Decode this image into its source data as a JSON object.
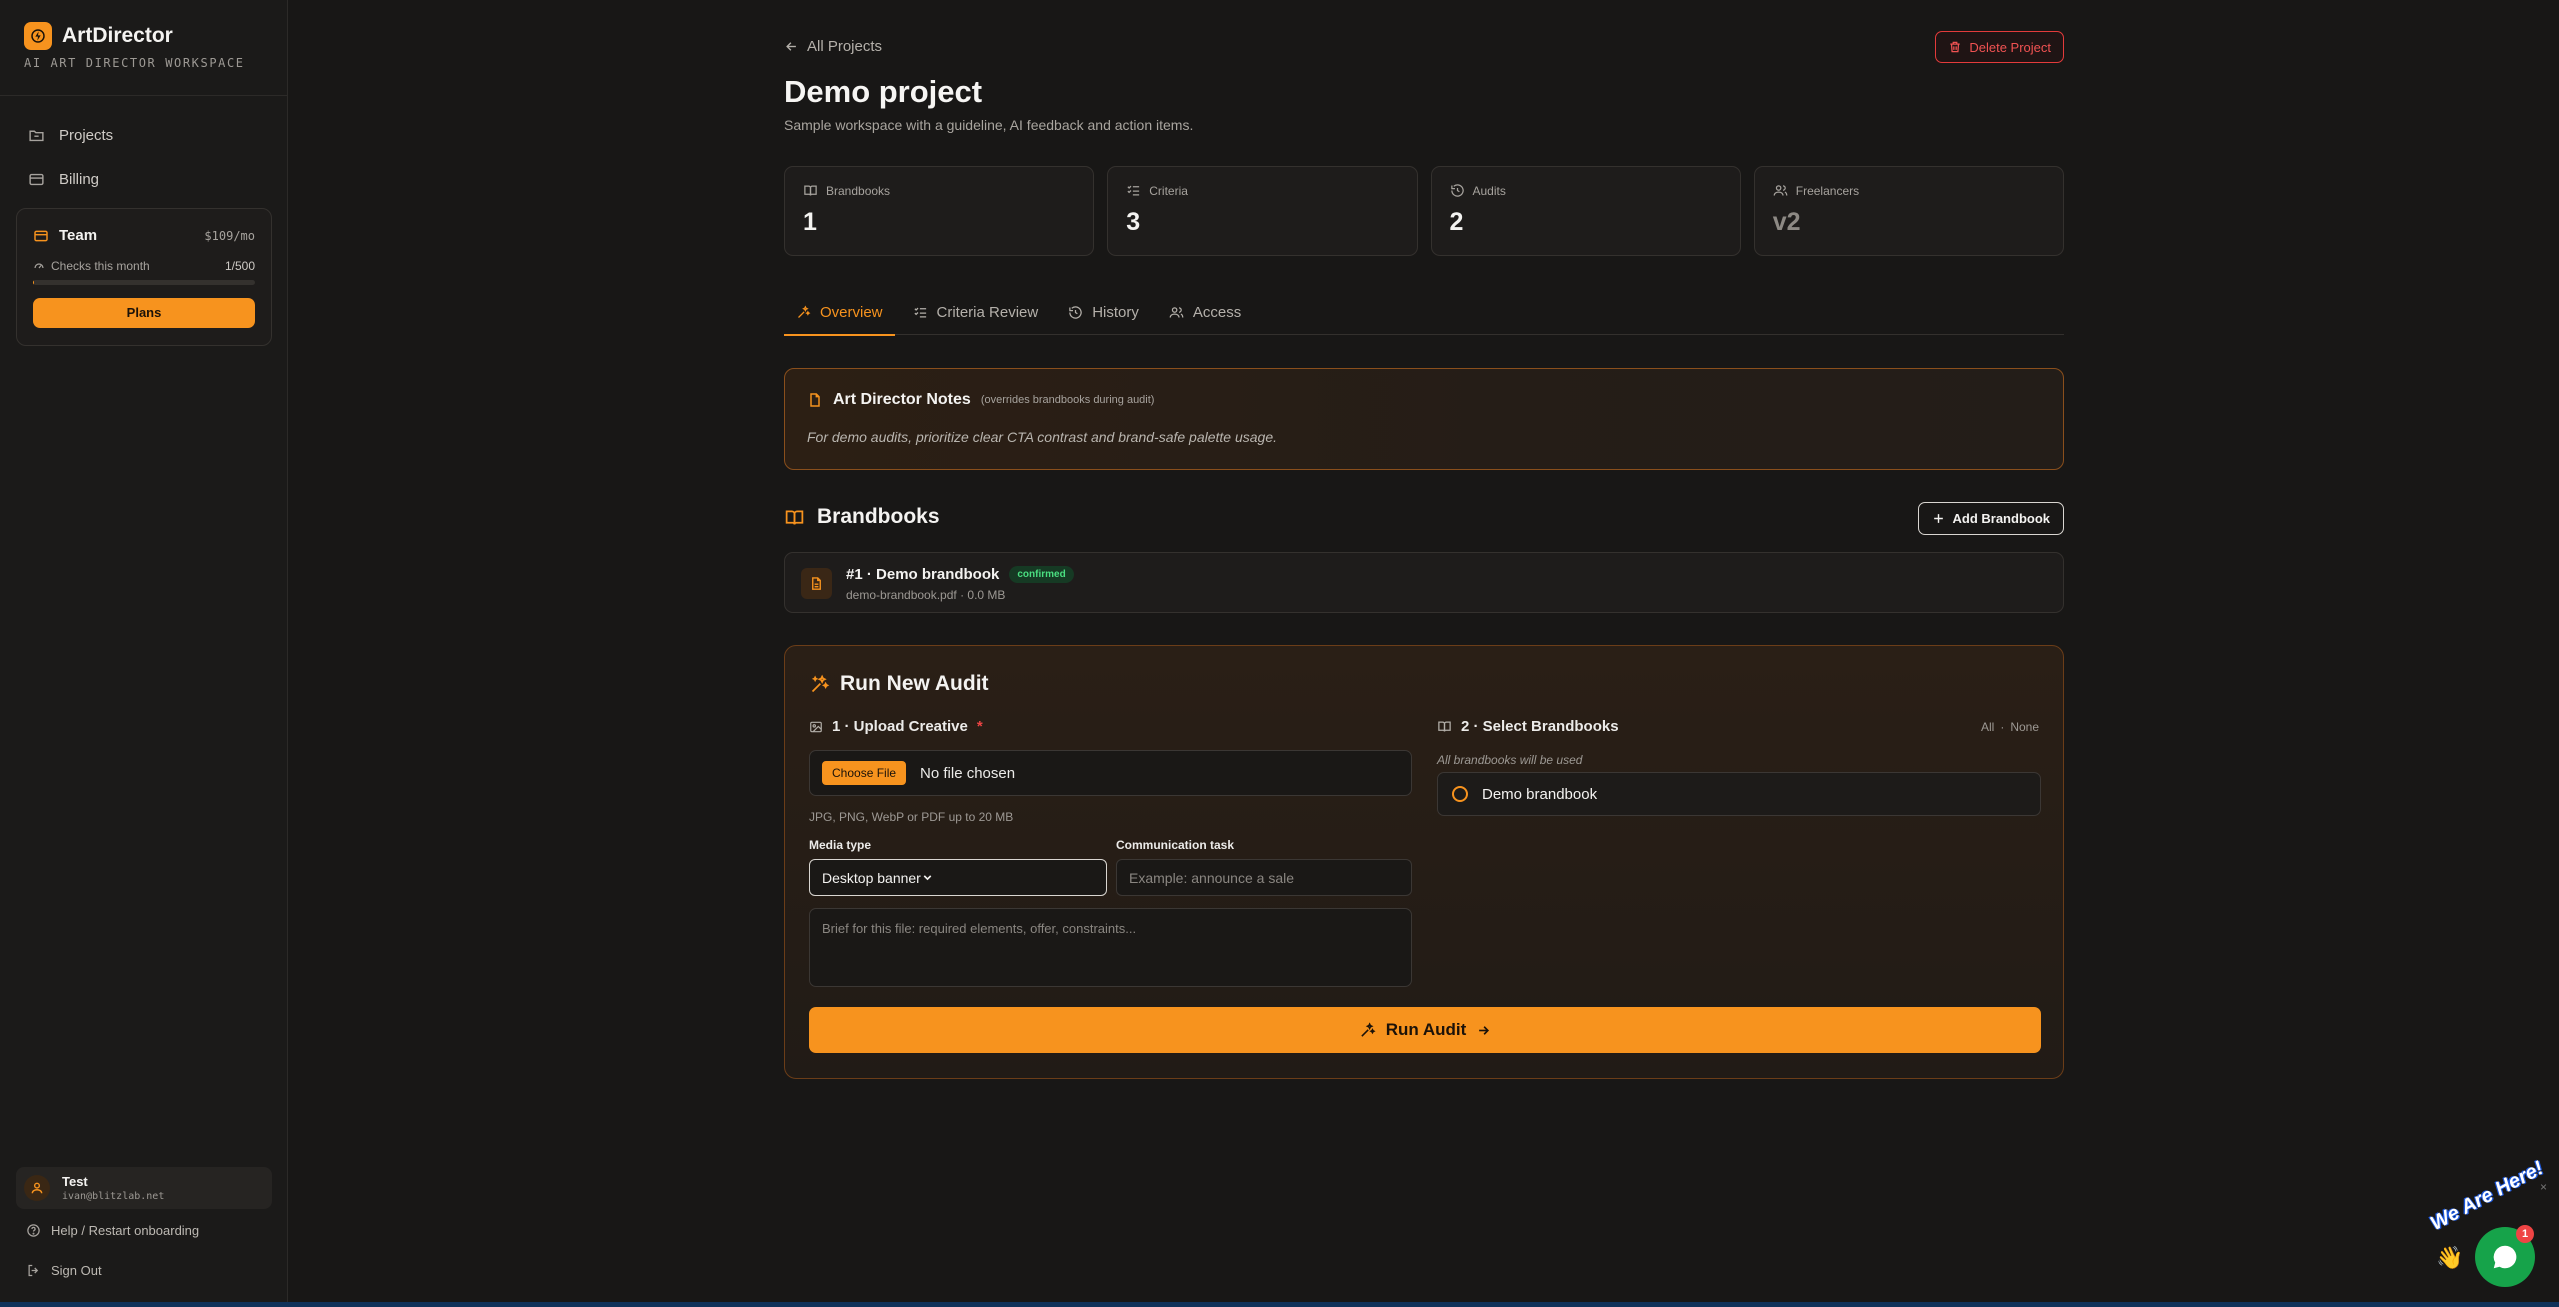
{
  "sidebar": {
    "brand": "ArtDirector",
    "brand_sub": "AI ART DIRECTOR WORKSPACE",
    "nav": [
      {
        "label": "Projects",
        "icon": "folder-icon"
      },
      {
        "label": "Billing",
        "icon": "credit-card-icon"
      }
    ],
    "plan": {
      "name": "Team",
      "price": "$109/mo",
      "checks_label": "Checks this month",
      "checks_value": "1/500",
      "checks_used_fraction": 0.002,
      "button": "Plans"
    },
    "user": {
      "name": "Test",
      "email": "ivan@blitzlab.net"
    },
    "help": "Help / Restart onboarding",
    "sign_out": "Sign Out"
  },
  "header": {
    "back": "All Projects",
    "delete": "Delete Project",
    "title": "Demo project",
    "subtitle": "Sample workspace with a guideline, AI feedback and action items."
  },
  "stats": [
    {
      "label": "Brandbooks",
      "value": "1",
      "icon": "book-icon"
    },
    {
      "label": "Criteria",
      "value": "3",
      "icon": "list-check-icon"
    },
    {
      "label": "Audits",
      "value": "2",
      "icon": "history-icon"
    },
    {
      "label": "Freelancers",
      "value": "v2",
      "icon": "users-icon"
    }
  ],
  "tabs": [
    {
      "label": "Overview",
      "active": true
    },
    {
      "label": "Criteria Review",
      "active": false
    },
    {
      "label": "History",
      "active": false
    },
    {
      "label": "Access",
      "active": false
    }
  ],
  "notes": {
    "title": "Art Director Notes",
    "hint": "(overrides brandbooks during audit)",
    "body": "For demo audits, prioritize clear CTA contrast and brand-safe palette usage."
  },
  "brandbooks": {
    "title": "Brandbooks",
    "add": "Add Brandbook",
    "items": [
      {
        "name": "#1 · Demo brandbook",
        "status": "confirmed",
        "meta": "demo-brandbook.pdf · 0.0 MB"
      }
    ]
  },
  "audit": {
    "title": "Run New Audit",
    "step1": "1 · Upload Creative",
    "required_mark": "*",
    "choose_file": "Choose File",
    "no_file": "No file chosen",
    "file_hint": "JPG, PNG, WebP or PDF up to 20 MB",
    "media_label": "Media type",
    "media_value": "Desktop banner",
    "task_label": "Communication task",
    "task_placeholder": "Example: announce a sale",
    "brief_placeholder": "Brief for this file: required elements, offer, constraints...",
    "step2": "2 · Select Brandbooks",
    "all": "All",
    "sep": "·",
    "none": "None",
    "all_note": "All brandbooks will be used",
    "option": "Demo brandbook",
    "run": "Run Audit"
  },
  "chat": {
    "banner": "We Are Here!",
    "badge": "1",
    "close": "×"
  },
  "colors": {
    "accent": "#f7931e",
    "danger": "#ef4444",
    "success": "#4ade80",
    "background": "#181716"
  }
}
